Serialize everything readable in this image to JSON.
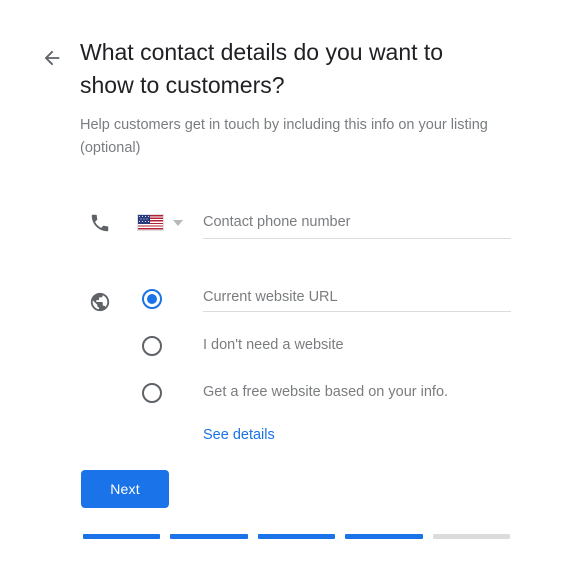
{
  "window": {
    "background": "#ffffff"
  },
  "header": {
    "back_icon": "arrow-left-icon",
    "title": "What contact details do you want to show to customers?",
    "subtitle": "Help customers get in touch by including this info on your listing (optional)"
  },
  "phone_field": {
    "icon": "phone-icon",
    "country_flag": "us-flag-icon",
    "country_dropdown_icon": "chevron-down-icon",
    "placeholder": "Contact phone number",
    "value": ""
  },
  "website_section": {
    "icon": "globe-icon",
    "selected_index": 0,
    "options": [
      {
        "type": "input",
        "label": "",
        "placeholder": "Current website URL",
        "value": "",
        "selected": true
      },
      {
        "type": "label",
        "label": "I don't need a website",
        "selected": false
      },
      {
        "type": "label",
        "label": "Get a free website based on your info.",
        "selected": false
      }
    ],
    "see_details_link": "See details"
  },
  "actions": {
    "next_label": "Next"
  },
  "progress": {
    "total_steps": 5,
    "completed_steps": 4,
    "segments": [
      "done",
      "done",
      "done",
      "done",
      "todo"
    ],
    "done_color": "#1a73e8",
    "todo_color": "#dbdcdd"
  },
  "colors": {
    "accent": "#1a73e8",
    "title_text": "#202124",
    "secondary_text": "#7a7d80",
    "divider": "#dadce0"
  }
}
